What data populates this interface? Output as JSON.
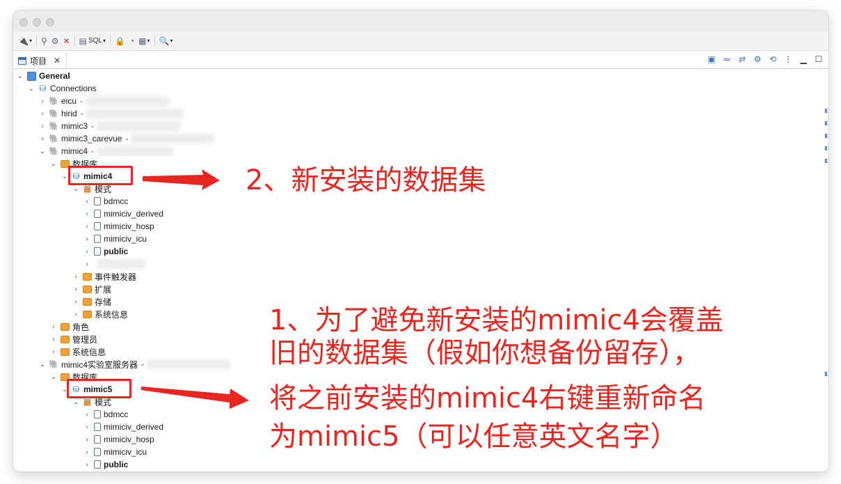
{
  "toolbar": {
    "sql_label": "SQL"
  },
  "tab": {
    "label": "项目"
  },
  "tree": {
    "project": "General",
    "connections": "Connections",
    "conn_eicu": "eicu",
    "conn_hirid": "hirid",
    "conn_mimic3": "mimic3",
    "conn_mimic3_carevue": "mimic3_carevue",
    "conn_mimic4": "mimic4",
    "dash": "-",
    "databases": "数据库",
    "db_mimic4": "mimic4",
    "schemas": "模式",
    "schemas_mimic4": [
      "bdmcc",
      "mimiciv_derived",
      "mimiciv_hosp",
      "mimiciv_icu",
      "public"
    ],
    "event_triggers": "事件触发器",
    "extensions": "扩展",
    "storage": "存储",
    "system_info": "系统信息",
    "roles": "角色",
    "admins": "管理员",
    "system_info2": "系统信息",
    "conn_lab": "mimic4实验室服务器",
    "databases2": "数据库",
    "db_mimic5": "mimic5",
    "schemas2": "模式",
    "schemas_mimic5": [
      "bdmcc",
      "mimiciv_derived",
      "mimiciv_hosp",
      "mimiciv_icu",
      "public"
    ]
  },
  "annotations": {
    "note2": "2、新安装的数据集",
    "note1_line1": "1、为了避免新安装的mimic4会覆盖",
    "note1_line2": "旧的数据集（假如你想备份留存），",
    "note1_line3": "将之前安装的mimic4右键重新命名",
    "note1_line4": "为mimic5（可以任意英文名字）"
  },
  "colors": {
    "annotation": "#e8261f",
    "accent": "#2a6bc1"
  }
}
